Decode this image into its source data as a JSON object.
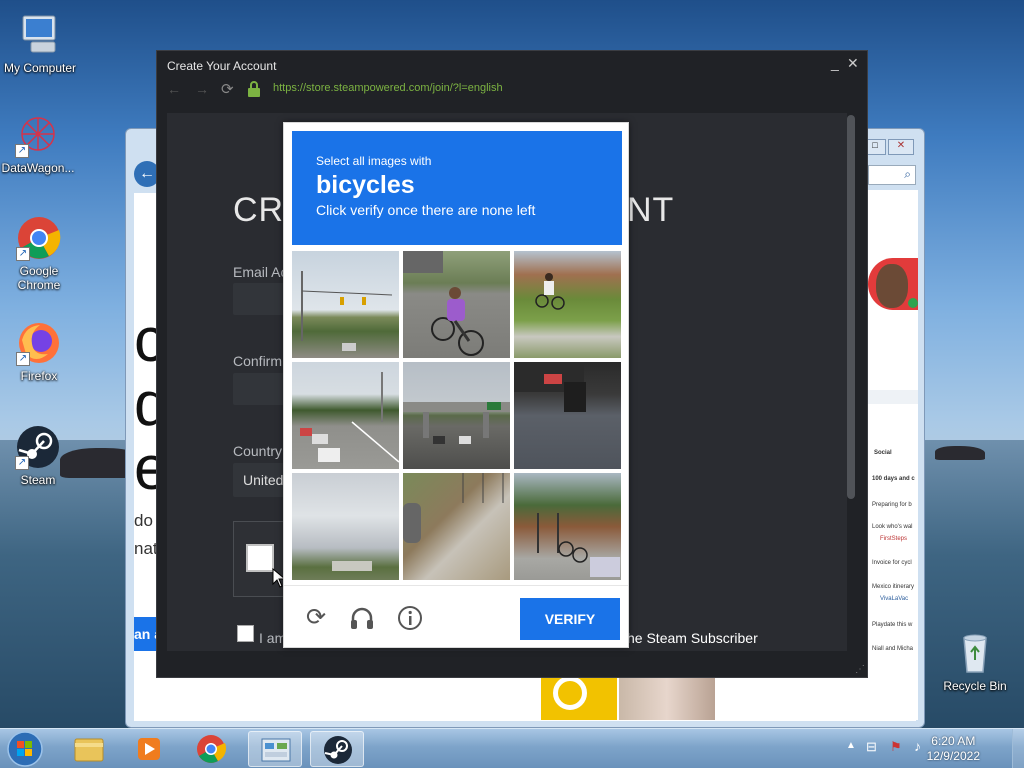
{
  "desktop": {
    "icons": [
      {
        "label": "My Computer"
      },
      {
        "label": "DataWagon..."
      },
      {
        "label": "Google Chrome"
      },
      {
        "label": "Firefox"
      },
      {
        "label": "Steam"
      },
      {
        "label": "Recycle Bin"
      }
    ]
  },
  "steam_window": {
    "title": "Create Your Account",
    "minimize": "_",
    "close": "✕",
    "url": "https://store.steampowered.com/join/?l=english",
    "heading_left": "CR",
    "heading_right": "NT",
    "email_label": "Email Ac",
    "confirm_label": "Confirm",
    "country_label": "Country",
    "country_value": "United",
    "agree_prefix": "I am",
    "agree_suffix": "he Steam Subscriber"
  },
  "background_window": {
    "big_letters": [
      "c",
      "d",
      "e"
    ],
    "side_text": [
      "do",
      "nat"
    ],
    "button_text": "an a",
    "feed": {
      "heading": "Social",
      "items": [
        "100 days and c",
        "Preparing for b",
        "Look who's wal",
        "FirstSteps",
        "Invoice for cycl",
        "Mexico itinerary",
        "VivaLaVac",
        "Playdate this w",
        "Niall and Micha"
      ]
    }
  },
  "captcha": {
    "instruction_line1": "Select all images with",
    "target_word": "bicycles",
    "instruction_line3": "Click verify once there are none left",
    "verify_label": "VERIFY",
    "tiles": [
      "road-intersection",
      "cyclist-purple-shirt",
      "cyclist-sidewalk",
      "road-cars",
      "overpass",
      "car-bumper",
      "cloudy-sky",
      "sidewalk-fence",
      "bicycle-fence"
    ]
  },
  "taskbar": {
    "time": "6:20 AM",
    "date": "12/9/2022"
  },
  "colors": {
    "captcha_blue": "#1a73e8",
    "url_green": "#7cb342",
    "steam_bg": "#202226"
  }
}
